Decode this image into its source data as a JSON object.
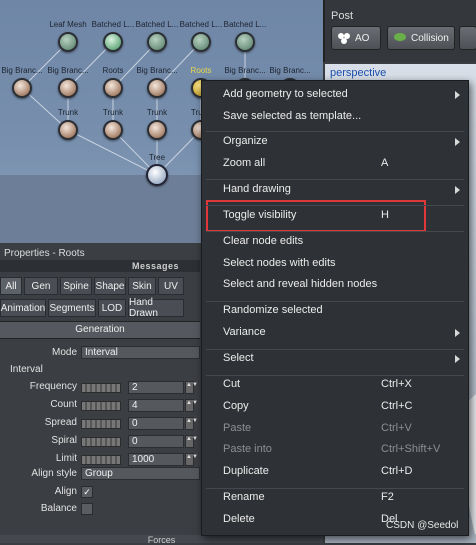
{
  "graph": {
    "nodes": [
      {
        "label": "Leaf Mesh",
        "kind": "leaf"
      },
      {
        "label": "Batched L...",
        "kind": "batch"
      },
      {
        "label": "Batched L...",
        "kind": "leaf"
      },
      {
        "label": "Batched L...",
        "kind": "leaf"
      },
      {
        "label": "Batched L...",
        "kind": "leaf"
      },
      {
        "label": "Big Branc...",
        "kind": "branch"
      },
      {
        "label": "Big Branc...",
        "kind": "branch"
      },
      {
        "label": "Roots",
        "kind": "branch"
      },
      {
        "label": "Big Branc...",
        "kind": "branch"
      },
      {
        "label": "Roots",
        "kind": "branch-hl"
      },
      {
        "label": "Big Branc...",
        "kind": "branch"
      },
      {
        "label": "Big Branc...",
        "kind": "branch"
      },
      {
        "label": "Trunk",
        "kind": "trunk"
      },
      {
        "label": "Trunk",
        "kind": "trunk"
      },
      {
        "label": "Trunk",
        "kind": "trunk"
      },
      {
        "label": "Trunk",
        "kind": "trunk"
      },
      {
        "label": "Tree",
        "kind": "tree"
      }
    ]
  },
  "post_panel": {
    "title": "Post",
    "ao_label": "AO",
    "collision_label": "Collision"
  },
  "viewport": {
    "label": "perspective"
  },
  "properties": {
    "title": "Properties - Roots",
    "messages_label": "Messages",
    "tabs_row1": [
      "All",
      "Gen",
      "Spine",
      "Shape",
      "Skin",
      "UV"
    ],
    "tabs_row2": [
      "Animation",
      "Segments",
      "LOD",
      "Hand Drawn"
    ],
    "section": "Generation",
    "mode_label": "Mode",
    "mode_value": "Interval",
    "interval_label": "Interval",
    "fields": [
      {
        "label": "Frequency",
        "value": "2"
      },
      {
        "label": "Count",
        "value": "4"
      },
      {
        "label": "Spread",
        "value": "0"
      },
      {
        "label": "Spiral",
        "value": "0"
      },
      {
        "label": "Limit",
        "value": "1000"
      }
    ],
    "align_style_label": "Align style",
    "align_style_value": "Group",
    "align_label": "Align",
    "align_checked": true,
    "balance_label": "Balance",
    "balance_checked": false,
    "forces_label": "Forces"
  },
  "context_menu": {
    "items": [
      {
        "label": "Add geometry to selected",
        "shortcut": "",
        "submenu": true,
        "disabled": false
      },
      {
        "label": "Save selected as template...",
        "shortcut": "",
        "submenu": false,
        "disabled": false
      },
      {
        "label": "Organize",
        "shortcut": "",
        "submenu": true,
        "disabled": false
      },
      {
        "label": "Zoom all",
        "shortcut": "A",
        "submenu": false,
        "disabled": false
      },
      {
        "label": "Hand drawing",
        "shortcut": "",
        "submenu": true,
        "disabled": false
      },
      {
        "label": "Toggle visibility",
        "shortcut": "H",
        "submenu": false,
        "disabled": false
      },
      {
        "label": "Clear node edits",
        "shortcut": "",
        "submenu": false,
        "disabled": false
      },
      {
        "label": "Select nodes with edits",
        "shortcut": "",
        "submenu": false,
        "disabled": false
      },
      {
        "label": "Select and reveal hidden nodes",
        "shortcut": "",
        "submenu": false,
        "disabled": false
      },
      {
        "label": "Randomize selected",
        "shortcut": "",
        "submenu": false,
        "disabled": false
      },
      {
        "label": "Variance",
        "shortcut": "",
        "submenu": true,
        "disabled": false
      },
      {
        "label": "Select",
        "shortcut": "",
        "submenu": true,
        "disabled": false
      },
      {
        "label": "Cut",
        "shortcut": "Ctrl+X",
        "submenu": false,
        "disabled": false
      },
      {
        "label": "Copy",
        "shortcut": "Ctrl+C",
        "submenu": false,
        "disabled": false
      },
      {
        "label": "Paste",
        "shortcut": "Ctrl+V",
        "submenu": false,
        "disabled": true
      },
      {
        "label": "Paste into",
        "shortcut": "Ctrl+Shift+V",
        "submenu": false,
        "disabled": true
      },
      {
        "label": "Duplicate",
        "shortcut": "Ctrl+D",
        "submenu": false,
        "disabled": false
      },
      {
        "label": "Rename",
        "shortcut": "F2",
        "submenu": false,
        "disabled": false
      },
      {
        "label": "Delete",
        "shortcut": "Del",
        "submenu": false,
        "disabled": false
      }
    ],
    "highlight_color": "#e0373a"
  },
  "watermark": "CSDN @Seedol"
}
